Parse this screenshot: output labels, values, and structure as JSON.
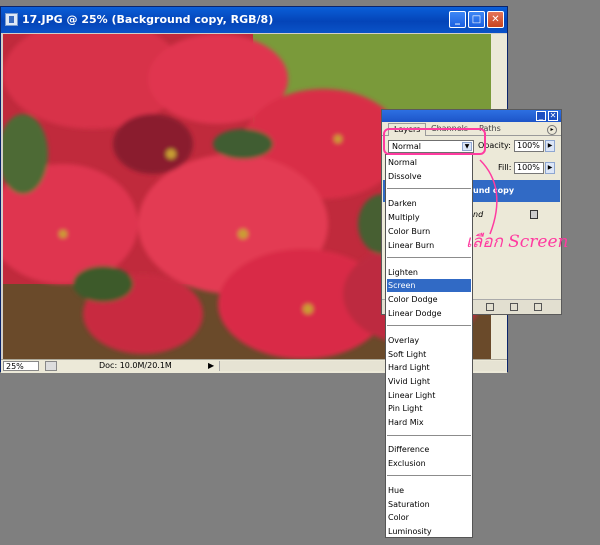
{
  "document": {
    "title": "17.JPG @ 25% (Background copy, RGB/8)",
    "zoom": "25%",
    "doc_info": "Doc: 10.0M/20.1M",
    "status_arrow": "▶",
    "buttons": {
      "minimize": "_",
      "maximize": "□",
      "close": "✕"
    }
  },
  "palette": {
    "tabs": [
      "Layers",
      "Channels",
      "Paths"
    ],
    "menu_icon": "▸",
    "blend_mode": "Normal",
    "opacity_label": "Opacity:",
    "opacity_value": "100%",
    "fill_label": "Fill:",
    "fill_value": "100%",
    "layers": [
      {
        "name": "und copy",
        "selected": true
      },
      {
        "name": "nd",
        "selected": false
      }
    ],
    "buttons": {
      "minimize": "_",
      "close": "✕"
    }
  },
  "blend_menu": {
    "groups": [
      [
        "Normal",
        "Dissolve"
      ],
      [
        "Darken",
        "Multiply",
        "Color Burn",
        "Linear Burn"
      ],
      [
        "Lighten",
        "Screen",
        "Color Dodge",
        "Linear Dodge"
      ],
      [
        "Overlay",
        "Soft Light",
        "Hard Light",
        "Vivid Light",
        "Linear Light",
        "Pin Light",
        "Hard Mix"
      ],
      [
        "Difference",
        "Exclusion"
      ],
      [
        "Hue",
        "Saturation",
        "Color",
        "Luminosity"
      ]
    ],
    "highlighted": "Screen"
  },
  "annotation": {
    "text": "เลือก Screen",
    "color": "#ff3ba0"
  },
  "colors": {
    "titlebar": "#0a53c8",
    "selection": "#316ac5",
    "background": "#7f7f7f"
  }
}
